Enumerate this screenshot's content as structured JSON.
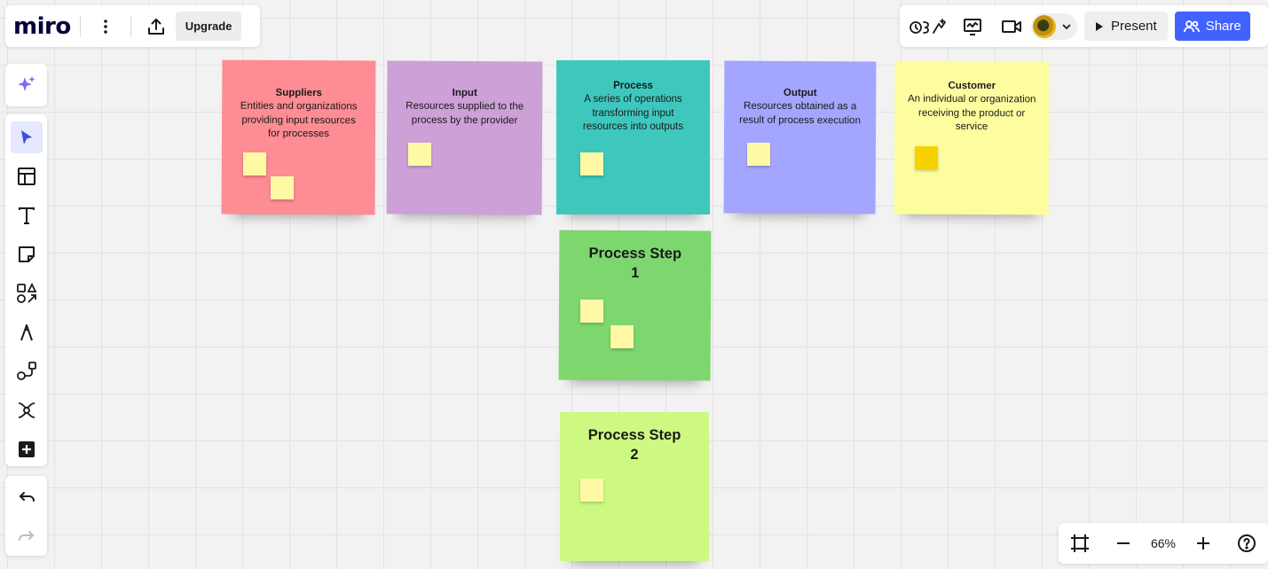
{
  "app": {
    "logo": "miro",
    "upgrade_label": "Upgrade"
  },
  "topbar": {
    "present_label": "Present",
    "share_label": "Share"
  },
  "toolbar": {
    "tools": [
      "select",
      "templates",
      "text",
      "sticky-note",
      "shapes",
      "pen",
      "comment",
      "mind-map",
      "more"
    ]
  },
  "zoom": {
    "level": "66%"
  },
  "stickies": {
    "suppliers": {
      "title": "Suppliers",
      "desc": "Entities and organizations providing input resources for processes",
      "color": "#fd8c94"
    },
    "input": {
      "title": "Input",
      "desc": "Resources supplied to the process by the provider",
      "color": "#cda0d7"
    },
    "process": {
      "title": "Process",
      "desc": "A series of operations transforming input resources into outputs",
      "color": "#3ec8bd"
    },
    "output": {
      "title": "Output",
      "desc": "Resources obtained as a result of process execution",
      "color": "#a4a5ff"
    },
    "customer": {
      "title": "Customer",
      "desc": "An individual or organization receiving the product or service",
      "color": "#fdfd9f"
    },
    "step1": {
      "title": "Process Step 1",
      "color": "#7ed66e"
    },
    "step2": {
      "title": "Process Step 2",
      "color": "#cdf982"
    }
  },
  "colors": {
    "accent": "#4262ff",
    "mini_sticky": "#fff9a6",
    "mini_sticky_highlight": "#f7d200"
  }
}
